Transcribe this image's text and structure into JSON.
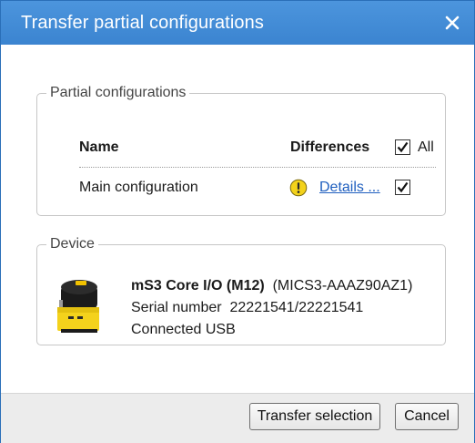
{
  "dialog": {
    "title": "Transfer partial configurations",
    "close_icon": "close-icon"
  },
  "partial_group": {
    "legend": "Partial configurations",
    "columns": {
      "name": "Name",
      "differences": "Differences",
      "all_label": "All"
    },
    "all_checked": true,
    "rows": [
      {
        "name": "Main configuration",
        "status_icon": "warning-icon",
        "details_label": "Details ...",
        "checked": true
      }
    ]
  },
  "device_group": {
    "legend": "Device",
    "device_image": "safety-scanner-image",
    "name": "mS3 Core I/O (M12)",
    "model": "(MICS3-AAAZ90AZ1)",
    "serial_label": "Serial number",
    "serial_value": "22221541/22221541",
    "connection": "Connected USB"
  },
  "footer": {
    "transfer_label": "Transfer selection",
    "cancel_label": "Cancel"
  },
  "colors": {
    "titlebar": "#3b84d0",
    "link": "#1f5fbf",
    "warning": "#f3d21b"
  }
}
